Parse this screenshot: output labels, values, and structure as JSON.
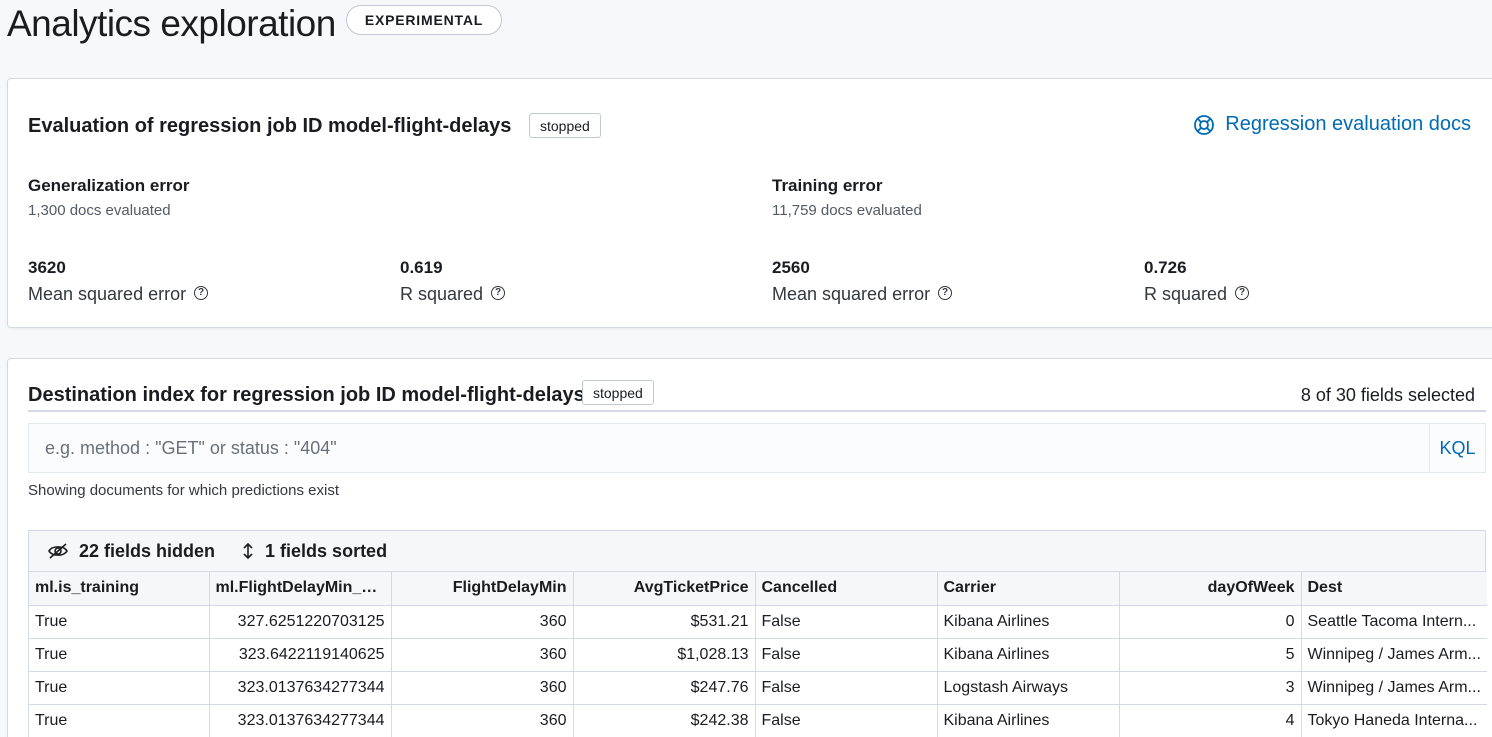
{
  "header": {
    "title": "Analytics exploration",
    "badge": "EXPERIMENTAL"
  },
  "evaluation": {
    "title": "Evaluation of regression job ID model-flight-delays",
    "status": "stopped",
    "docs_link": "Regression evaluation docs",
    "generalization": {
      "heading": "Generalization error",
      "docs_evaluated": "1,300 docs evaluated",
      "mse_value": "3620",
      "mse_label": "Mean squared error",
      "rsq_value": "0.619",
      "rsq_label": "R squared"
    },
    "training": {
      "heading": "Training error",
      "docs_evaluated": "11,759 docs evaluated",
      "mse_value": "2560",
      "mse_label": "Mean squared error",
      "rsq_value": "0.726",
      "rsq_label": "R squared"
    }
  },
  "destination": {
    "title": "Destination index for regression job ID model-flight-delays",
    "status": "stopped",
    "fields_selected": "8 of 30 fields selected",
    "search_placeholder": "e.g. method : \"GET\" or status : \"404\"",
    "kql_label": "KQL",
    "showing_note": "Showing documents for which predictions exist",
    "toolbar": {
      "hidden_label": "22 fields hidden",
      "sorted_label": "1 fields sorted"
    },
    "columns": [
      "ml.is_training",
      "ml.FlightDelayMin_pr...",
      "FlightDelayMin",
      "AvgTicketPrice",
      "Cancelled",
      "Carrier",
      "dayOfWeek",
      "Dest"
    ],
    "rows": [
      [
        "True",
        "327.6251220703125",
        "360",
        "$531.21",
        "False",
        "Kibana Airlines",
        "0",
        "Seattle Tacoma Intern..."
      ],
      [
        "True",
        "323.6422119140625",
        "360",
        "$1,028.13",
        "False",
        "Kibana Airlines",
        "5",
        "Winnipeg / James Arm..."
      ],
      [
        "True",
        "323.0137634277344",
        "360",
        "$247.76",
        "False",
        "Logstash Airways",
        "3",
        "Winnipeg / James Arm..."
      ],
      [
        "True",
        "323.0137634277344",
        "360",
        "$242.38",
        "False",
        "Kibana Airlines",
        "4",
        "Tokyo Haneda Interna..."
      ]
    ]
  },
  "colors": {
    "link": "#006bb4",
    "border": "#d3dae6",
    "background": "#f7f8fc"
  }
}
